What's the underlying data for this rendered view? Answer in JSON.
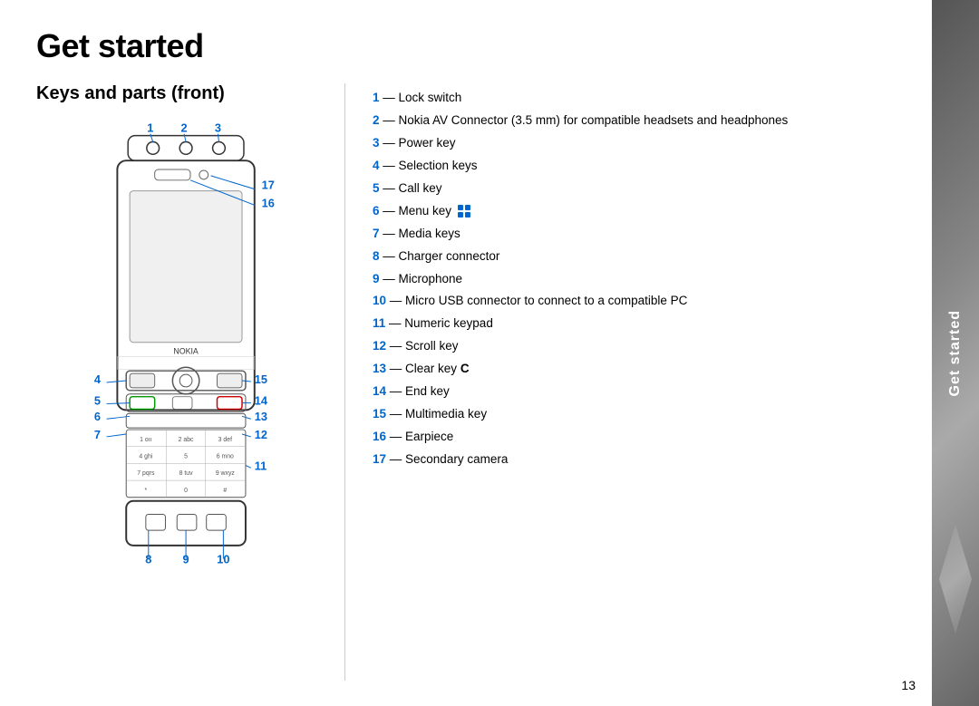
{
  "page": {
    "title": "Get started",
    "section_title": "Keys and parts (front)",
    "page_number": "13",
    "sidebar_label": "Get started"
  },
  "keys": [
    {
      "number": "1",
      "dash": "—",
      "text": "Lock switch"
    },
    {
      "number": "2",
      "dash": "—",
      "text": "Nokia AV Connector (3.5 mm) for compatible headsets and headphones"
    },
    {
      "number": "3",
      "dash": "—",
      "text": "Power key"
    },
    {
      "number": "4",
      "dash": "—",
      "text": "Selection keys"
    },
    {
      "number": "5",
      "dash": "—",
      "text": "Call key"
    },
    {
      "number": "6",
      "dash": "—",
      "text": "Menu key",
      "has_icon": true
    },
    {
      "number": "7",
      "dash": "—",
      "text": "Media keys"
    },
    {
      "number": "8",
      "dash": "—",
      "text": "Charger connector"
    },
    {
      "number": "9",
      "dash": "—",
      "text": "Microphone"
    },
    {
      "number": "10",
      "dash": "—",
      "text": "Micro USB connector to connect to a compatible PC"
    },
    {
      "number": "11",
      "dash": "—",
      "text": "Numeric keypad"
    },
    {
      "number": "12",
      "dash": "—",
      "text": "Scroll key"
    },
    {
      "number": "13",
      "dash": "—",
      "text": "Clear key",
      "bold_suffix": "C"
    },
    {
      "number": "14",
      "dash": "—",
      "text": "End key"
    },
    {
      "number": "15",
      "dash": "—",
      "text": "Multimedia key"
    },
    {
      "number": "16",
      "dash": "—",
      "text": "Earpiece"
    },
    {
      "number": "17",
      "dash": "—",
      "text": "Secondary camera"
    }
  ],
  "colors": {
    "blue": "#0066cc",
    "dark": "#333",
    "sidebar_bg": "#777"
  }
}
